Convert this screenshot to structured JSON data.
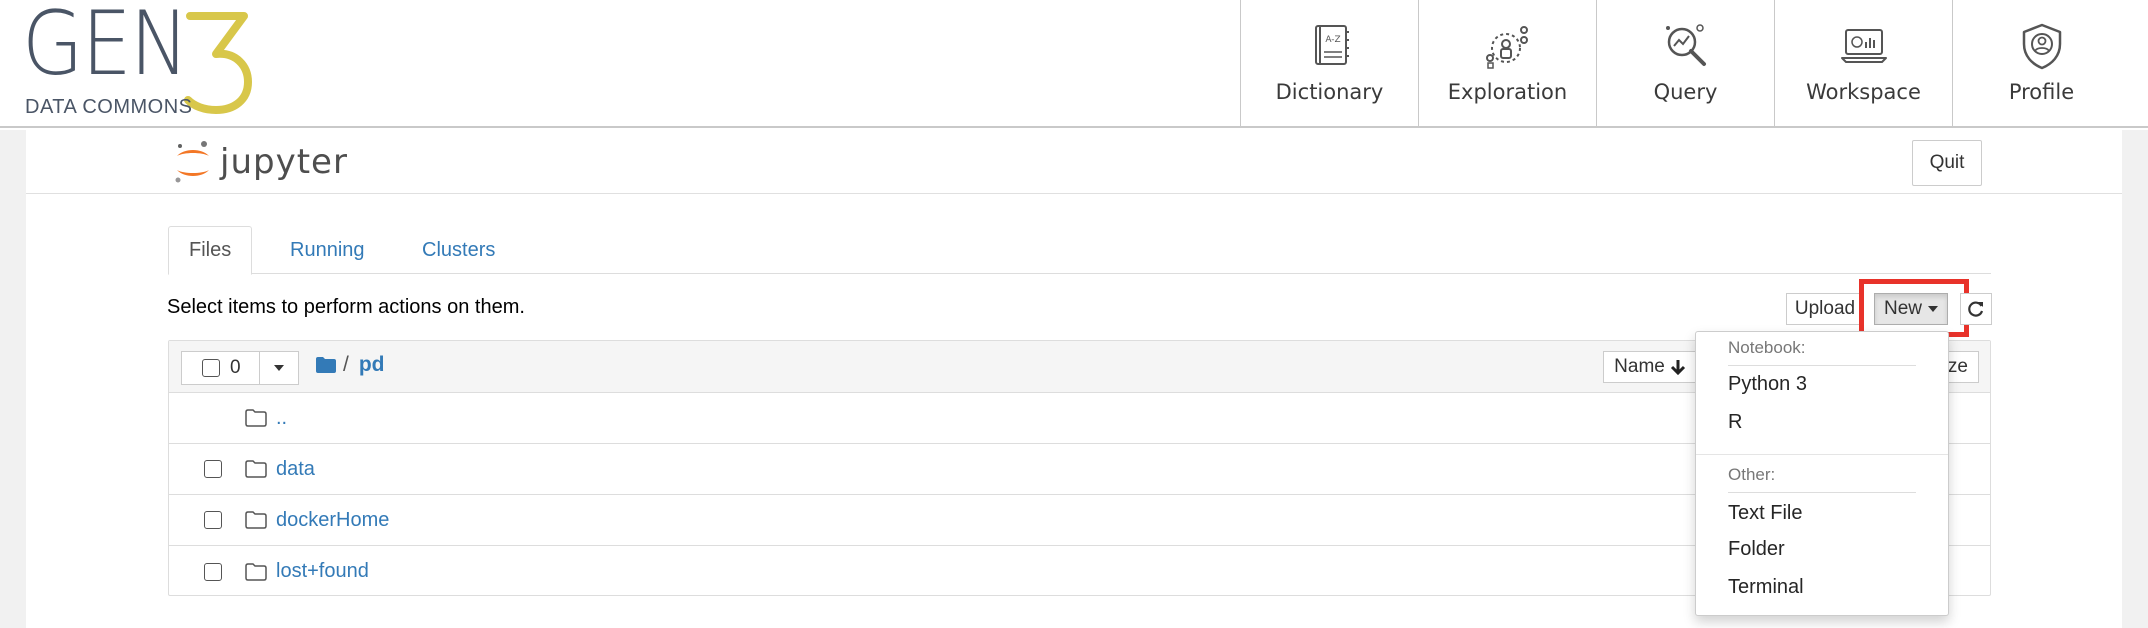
{
  "brand": {
    "logo_main": "GEN",
    "logo_number": "3",
    "logo_sub": "DATA COMMONS",
    "colors": {
      "logo_text": "#4a5566",
      "logo_three": "#d8c74a"
    }
  },
  "nav": {
    "items": [
      {
        "label": "Dictionary",
        "icon": "dictionary-book-icon"
      },
      {
        "label": "Exploration",
        "icon": "exploration-icon"
      },
      {
        "label": "Query",
        "icon": "query-magnifier-icon"
      },
      {
        "label": "Workspace",
        "icon": "workspace-laptop-icon"
      },
      {
        "label": "Profile",
        "icon": "profile-shield-icon"
      }
    ]
  },
  "jupyter": {
    "logo_text": "jupyter",
    "quit_label": "Quit",
    "tabs": [
      {
        "label": "Files",
        "active": true
      },
      {
        "label": "Running",
        "active": false
      },
      {
        "label": "Clusters",
        "active": false
      }
    ],
    "select_hint": "Select items to perform actions on them.",
    "toolbar": {
      "upload_label": "Upload",
      "new_label": "New",
      "refresh_icon": "refresh-icon"
    },
    "list": {
      "selected_count": "0",
      "breadcrumb_root_sep": "/",
      "breadcrumb_dir": "pd",
      "sort_name_label": "Name",
      "sort_size_label": "ze",
      "entries": [
        {
          "name": "..",
          "type": "folder",
          "checkbox": false
        },
        {
          "name": "data",
          "type": "folder",
          "checkbox": true
        },
        {
          "name": "dockerHome",
          "type": "folder",
          "checkbox": true
        },
        {
          "name": "lost+found",
          "type": "folder",
          "checkbox": true
        }
      ]
    },
    "new_menu": {
      "notebook_header": "Notebook:",
      "notebook_items": [
        "Python 3",
        "R"
      ],
      "other_header": "Other:",
      "other_items": [
        "Text File",
        "Folder",
        "Terminal"
      ]
    }
  },
  "colors": {
    "link": "#337ab7",
    "highlight": "#e8322a",
    "jupyter_orange": "#f37726"
  }
}
